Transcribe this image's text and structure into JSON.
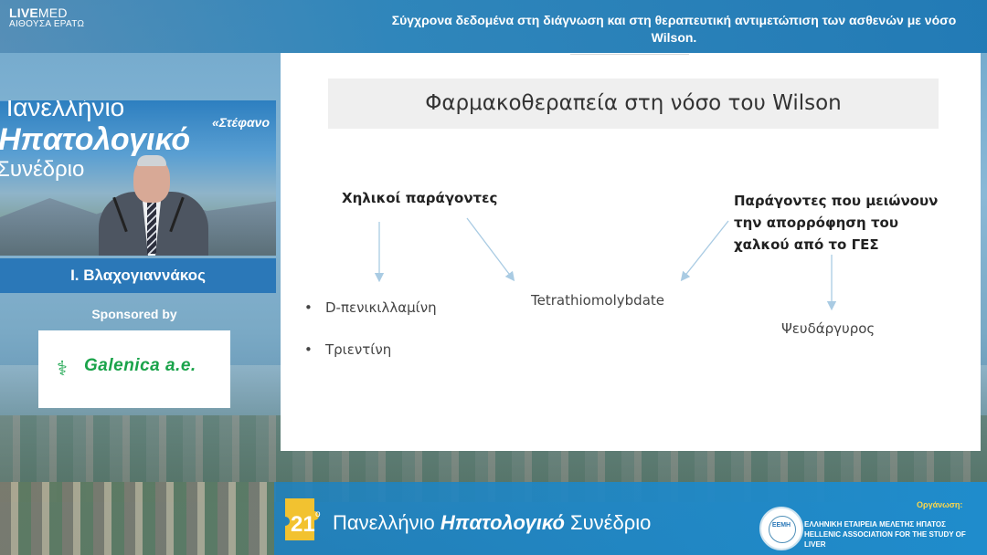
{
  "broadcast": {
    "logo_bold": "LIVE",
    "logo_thin": "MED",
    "room": "ΑΙΘΟΥΣΑ ΕΡΑΤΩ",
    "talk_title_line1": "Σύγχρονα δεδομένα στη διάγνωση και στη θεραπευτική αντιμετώπιση των ασθενών με νόσο",
    "talk_title_line2": "Wilson."
  },
  "video": {
    "banner_line1": "Πανελλήνιο",
    "banner_line2": "Ηπατολογικό",
    "banner_line3": "Συνέδριο",
    "banner_quote": "«Στέφανο"
  },
  "speaker": {
    "name": "Ι. Βλαχογιαννάκος"
  },
  "sponsor": {
    "label": "Sponsored by",
    "company": "Galenica a.e."
  },
  "slide": {
    "title": "Φαρμακοθεραπεία στη νόσο του Wilson",
    "left_header": "Χηλικοί παράγοντες",
    "right_header_line1": "Παράγοντες που μειώνουν",
    "right_header_line2": "την απορρόφηση του",
    "right_header_line3": "χαλκού από το ΓΕΣ",
    "chelators": [
      "D-πενικιλλαμίνη",
      "Τριεντίνη"
    ],
    "bullet": "•",
    "middle_item": "Tetrathiomolybdate",
    "right_item": "Ψευδάργυρος"
  },
  "footer": {
    "edition": "21",
    "edition_suffix": "ο",
    "conf_part1": "Πανελλήνιο",
    "conf_part2": "Ηπατολογικό",
    "conf_part3": "Συνέδριο",
    "organizer_label": "Οργάνωση:",
    "org_name_gr": "ΕΛΛΗΝΙΚΗ ΕΤΑΙΡΕΙΑ ΜΕΛΕΤΗΣ ΗΠΑΤΟΣ",
    "org_name_en": "HELLENIC ASSOCIATION FOR THE STUDY OF LIVER",
    "org_logo_text": "ΕΕΜΗ"
  },
  "colors": {
    "accent_blue": "#2b78b8",
    "sponsor_green": "#1aa34a",
    "organizer_yellow": "#ffd84a",
    "slide_arrow": "#a9cbe3"
  }
}
